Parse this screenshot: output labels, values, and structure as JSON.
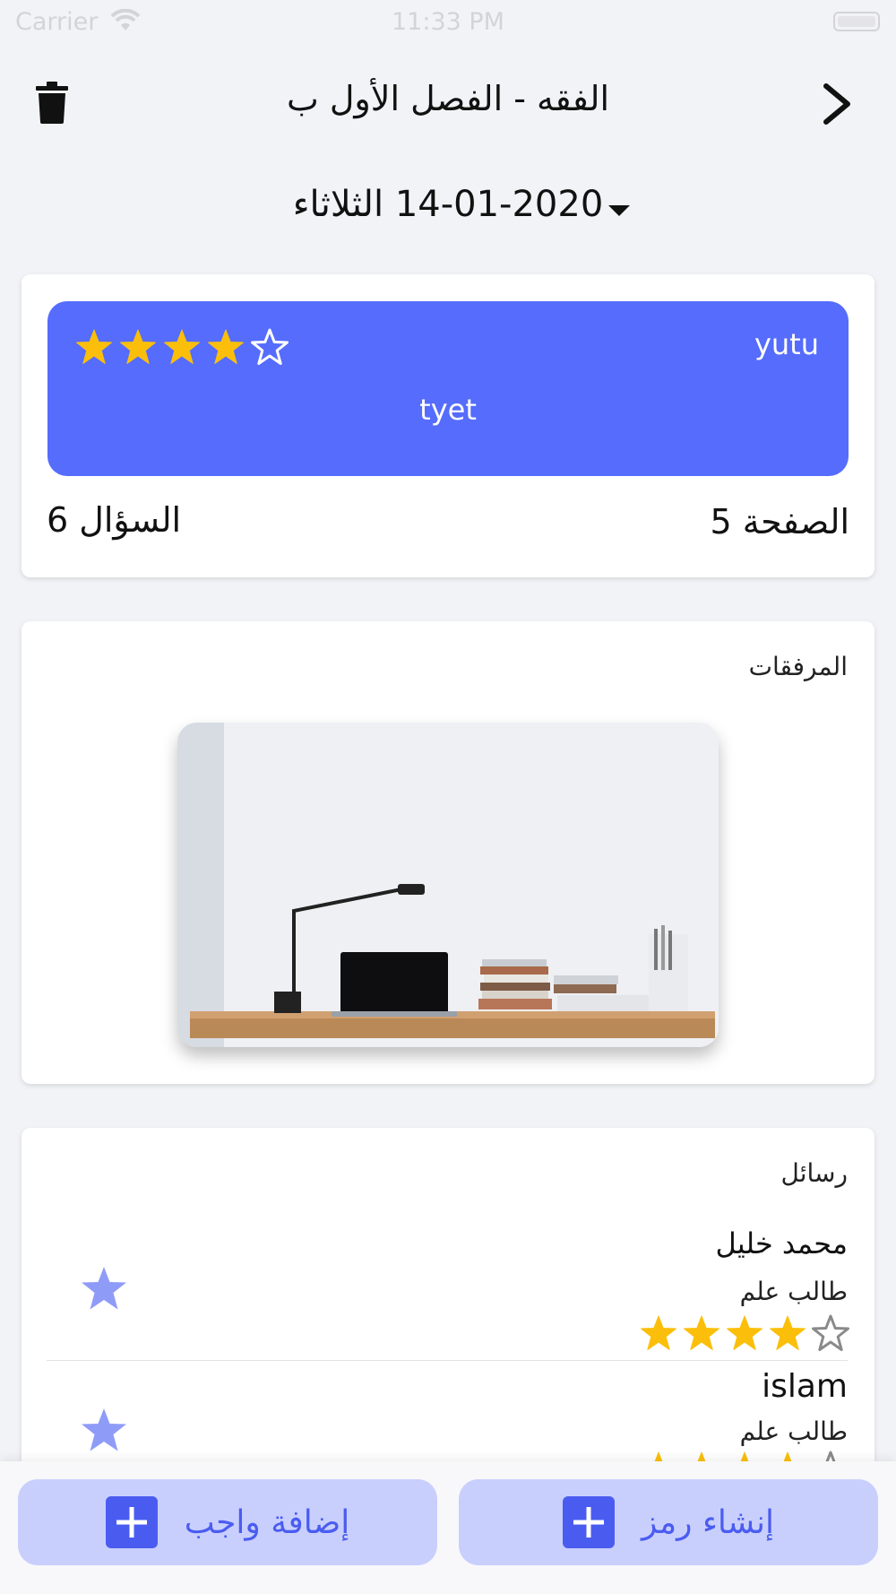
{
  "status_bar": {
    "carrier": "Carrier",
    "time": "11:33 PM"
  },
  "header": {
    "title": "الفقه - الفصل الأول ب",
    "delete_icon": "trash-icon",
    "back_icon": "chevron-right-icon"
  },
  "date_selector": {
    "value": "14-01-2020 الثلاثاء",
    "caret_icon": "caret-down-icon"
  },
  "lesson_card": {
    "name": "yutu",
    "subtitle": "tyet",
    "rating": 4,
    "rating_max": 5,
    "page_label": "الصفحة 5",
    "question_label": "السؤال 6",
    "accent_color": "#556cfd",
    "star_color": "#fbbf0b"
  },
  "attachments": {
    "title": "المرفقات",
    "image_alt": "desk-with-laptop-and-books"
  },
  "messages": {
    "title": "رسائل",
    "items": [
      {
        "name": "محمد خليل",
        "role": "طالب علم",
        "rating": 4,
        "rating_max": 5
      },
      {
        "name": "islam",
        "role": "طالب علم",
        "rating": 4,
        "rating_max": 5
      }
    ],
    "favorite_color": "#8f9cf7"
  },
  "actions": {
    "create_code": "إنشاء رمز",
    "add_homework": "إضافة واجب",
    "button_bg": "#c9cffd",
    "button_fg": "#4a5cf0"
  }
}
